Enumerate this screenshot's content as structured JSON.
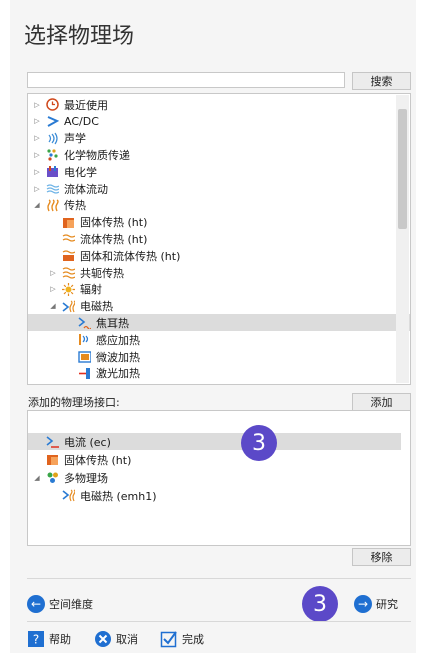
{
  "title": "选择物理场",
  "search": {
    "placeholder": "",
    "button": "搜索"
  },
  "tree": [
    {
      "label": "最近使用",
      "indent": 0,
      "arrow": "▷",
      "icon": "recent-icon"
    },
    {
      "label": "AC/DC",
      "indent": 0,
      "arrow": "▷",
      "icon": "acdc-icon"
    },
    {
      "label": "声学",
      "indent": 0,
      "arrow": "▷",
      "icon": "acoustics-icon"
    },
    {
      "label": "化学物质传递",
      "indent": 0,
      "arrow": "▷",
      "icon": "chemical-transport-icon"
    },
    {
      "label": "电化学",
      "indent": 0,
      "arrow": "▷",
      "icon": "electrochemistry-icon"
    },
    {
      "label": "流体流动",
      "indent": 0,
      "arrow": "▷",
      "icon": "fluid-flow-icon"
    },
    {
      "label": "传热",
      "indent": 0,
      "arrow": "◢",
      "icon": "heat-transfer-icon"
    },
    {
      "label": "固体传热 (ht)",
      "indent": 1,
      "arrow": "",
      "icon": "solid-heat-icon"
    },
    {
      "label": "流体传热 (ht)",
      "indent": 1,
      "arrow": "",
      "icon": "fluid-heat-icon"
    },
    {
      "label": "固体和流体传热 (ht)",
      "indent": 1,
      "arrow": "",
      "icon": "solid-fluid-heat-icon"
    },
    {
      "label": "共轭传热",
      "indent": 1,
      "arrow": "▷",
      "icon": "conjugate-heat-icon"
    },
    {
      "label": "辐射",
      "indent": 1,
      "arrow": "▷",
      "icon": "radiation-icon"
    },
    {
      "label": "电磁热",
      "indent": 1,
      "arrow": "◢",
      "icon": "electromagnetic-heat-icon"
    },
    {
      "label": "焦耳热",
      "indent": 2,
      "arrow": "",
      "icon": "joule-heat-icon",
      "selected": true
    },
    {
      "label": "感应加热",
      "indent": 2,
      "arrow": "",
      "icon": "induction-heating-icon"
    },
    {
      "label": "微波加热",
      "indent": 2,
      "arrow": "",
      "icon": "microwave-heating-icon"
    },
    {
      "label": "激光加热",
      "indent": 2,
      "arrow": "",
      "icon": "laser-heating-icon"
    }
  ],
  "add_button": "添加",
  "added_label": "添加的物理场接口:",
  "added": [
    {
      "label": "电流 (ec)",
      "indent": 0,
      "arrow": "",
      "icon": "electric-current-icon",
      "selected": true
    },
    {
      "label": "固体传热 (ht)",
      "indent": 0,
      "arrow": "",
      "icon": "solid-heat-icon"
    },
    {
      "label": "多物理场",
      "indent": 0,
      "arrow": "◢",
      "icon": "multiphysics-icon"
    },
    {
      "label": "电磁热 (emh1)",
      "indent": 1,
      "arrow": "",
      "icon": "emh-icon"
    }
  ],
  "remove_button": "移除",
  "badge": "3",
  "nav": {
    "back": "空间维度",
    "next": "研究"
  },
  "footer": {
    "help": "帮助",
    "cancel": "取消",
    "done": "完成"
  },
  "colors": {
    "accent": "#1f6fd1",
    "badge": "#5b49c8",
    "selection": "#dcdcdc"
  }
}
